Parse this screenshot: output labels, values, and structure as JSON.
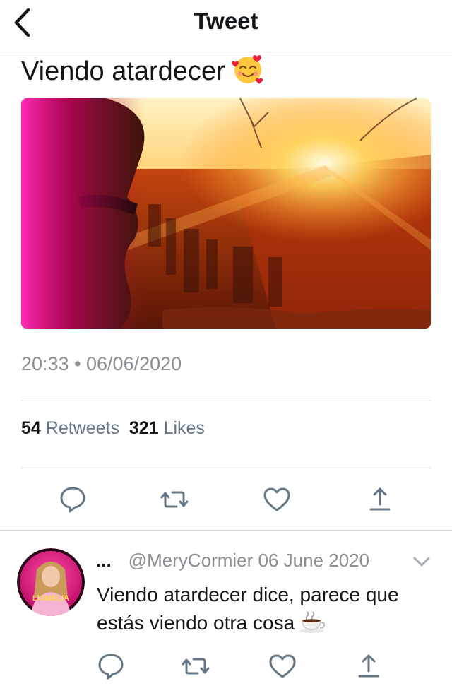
{
  "header": {
    "title": "Tweet",
    "back_icon": "chevron-left-icon"
  },
  "tweet": {
    "text": "Viendo atardecer",
    "text_emoji": "smiling-face-with-hearts-emoji",
    "media_description_icon": "sunset-photo",
    "timestamp": "20:33 • 06/06/2020",
    "retweets_count": "54",
    "retweets_label": "Retweets",
    "likes_count": "321",
    "likes_label": "Likes",
    "actions": [
      "reply-icon",
      "retweet-icon",
      "like-icon",
      "share-icon"
    ]
  },
  "reply": {
    "name": "...",
    "handle_date": "@MeryCormier 06 June 2020",
    "text": "Viendo atardecer dice, parece que estás viendo otra cosa",
    "text_emoji": "hot-beverage-emoji",
    "avatar_text": "LUIMELIA",
    "actions": [
      "reply-icon",
      "retweet-icon",
      "like-icon",
      "share-icon"
    ]
  },
  "colors": {
    "icon": "#657786",
    "muted": "#8a8f94",
    "text": "#14171a",
    "accent_pink": "#e6007e"
  }
}
